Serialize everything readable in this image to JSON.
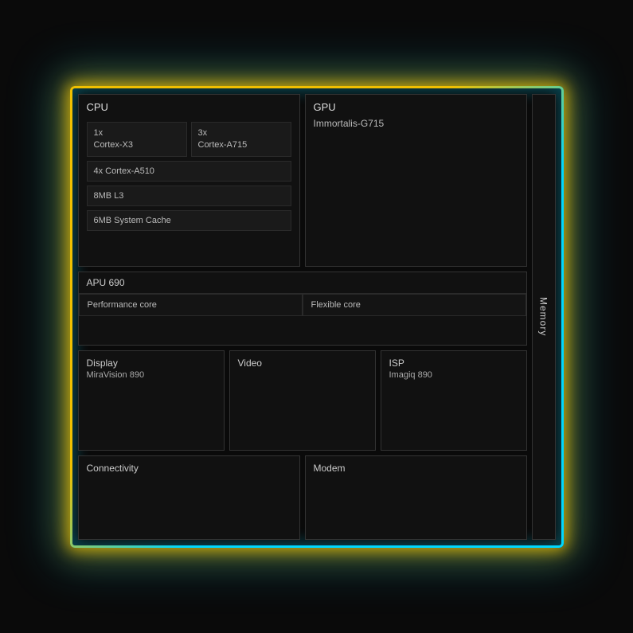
{
  "chip": {
    "sections": {
      "cpu": {
        "label": "CPU",
        "core1_count": "1x",
        "core1_name": "Cortex-X3",
        "core2_count": "3x",
        "core2_name": "Cortex-A715",
        "core3": "4x Cortex-A510",
        "cache1": "8MB L3",
        "cache2": "6MB System Cache"
      },
      "gpu": {
        "label": "GPU",
        "name": "Immortalis-G715"
      },
      "apu": {
        "label": "APU 690",
        "perf_core": "Performance core",
        "flex_core": "Flexible core"
      },
      "display": {
        "label": "Display",
        "name": "MiraVision 890"
      },
      "video": {
        "label": "Video"
      },
      "isp": {
        "label": "ISP",
        "name": "Imagiq 890"
      },
      "connectivity": {
        "label": "Connectivity"
      },
      "modem": {
        "label": "Modem"
      },
      "memory": {
        "label": "Memory"
      }
    }
  }
}
